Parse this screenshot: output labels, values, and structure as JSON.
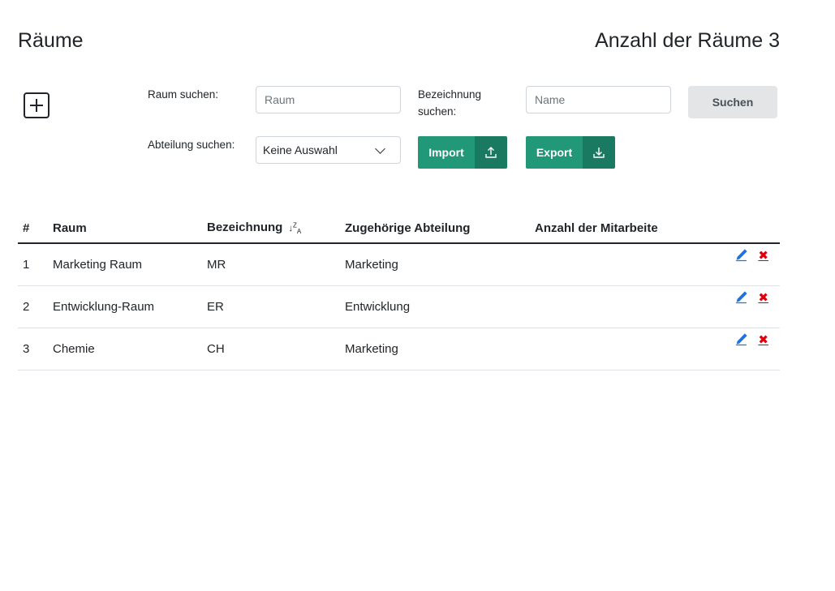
{
  "header": {
    "title": "Räume",
    "count_label": "Anzahl der Räume 3"
  },
  "search": {
    "raum_label": "Raum suchen:",
    "raum_placeholder": "Raum",
    "bezeichnung_label_1": "Bezeichnung",
    "bezeichnung_label_2": "suchen:",
    "bezeichnung_placeholder": "Name",
    "search_button": "Suchen",
    "abteilung_label": "Abteilung suchen:",
    "abteilung_value": "Keine Auswahl",
    "import_button": "Import",
    "export_button": "Export"
  },
  "table": {
    "headers": [
      "#",
      "Raum",
      "Bezeichnung",
      "Zugehörige Abteilung",
      "Anzahl der Mitarbeite"
    ],
    "rows": [
      {
        "num": "1",
        "raum": "Marketing Raum",
        "bezeichnung": "MR",
        "abteilung": "Marketing",
        "anzahl": ""
      },
      {
        "num": "2",
        "raum": "Entwicklung-Raum",
        "bezeichnung": "ER",
        "abteilung": "Entwicklung",
        "anzahl": ""
      },
      {
        "num": "3",
        "raum": "Chemie",
        "bezeichnung": "CH",
        "abteilung": "Marketing",
        "anzahl": ""
      }
    ],
    "delete_glyph": "✖"
  },
  "colors": {
    "accent": "#219877",
    "accent_dark": "#197a61",
    "edit": "#1a73e8",
    "delete": "#e0000c"
  },
  "icons": {
    "add": "plus-square-icon",
    "import": "upload-icon",
    "export": "download-icon",
    "sort": "sort-alpha-desc-icon",
    "edit": "pencil-icon",
    "delete": "close-icon"
  }
}
